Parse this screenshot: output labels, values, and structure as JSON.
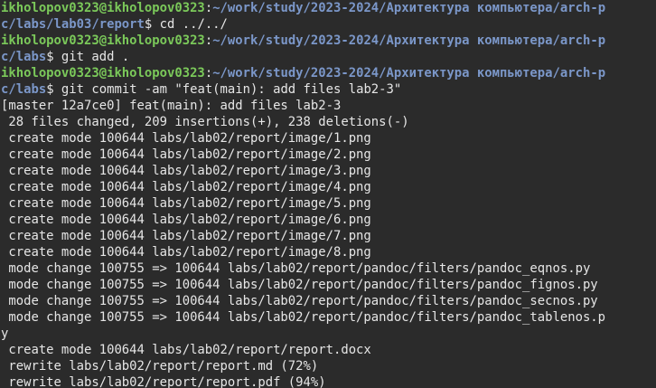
{
  "terminal": {
    "prompt_lines": [
      {
        "path": "~/work/study/2023-2024/Архитектура компьютера/arch-p",
        "cont": "c/labs/lab03/report",
        "cmd": " cd ../../"
      },
      {
        "path": "~/work/study/2023-2024/Архитектура компьютера/arch-p",
        "cont": "c/labs",
        "cmd": " git add ."
      },
      {
        "path": "~/work/study/2023-2024/Архитектура компьютера/arch-p",
        "cont": "c/labs",
        "cmd": " git commit -am \"feat(main): add files lab2-3\""
      }
    ],
    "user_host": "ikholopov0323@ikholopov0323",
    "sep": ":",
    "dollar": "$",
    "output": [
      "[master 12a7ce0] feat(main): add files lab2-3",
      " 28 files changed, 209 insertions(+), 238 deletions(-)",
      " create mode 100644 labs/lab02/report/image/1.png",
      " create mode 100644 labs/lab02/report/image/2.png",
      " create mode 100644 labs/lab02/report/image/3.png",
      " create mode 100644 labs/lab02/report/image/4.png",
      " create mode 100644 labs/lab02/report/image/5.png",
      " create mode 100644 labs/lab02/report/image/6.png",
      " create mode 100644 labs/lab02/report/image/7.png",
      " create mode 100644 labs/lab02/report/image/8.png",
      " mode change 100755 => 100644 labs/lab02/report/pandoc/filters/pandoc_eqnos.py",
      " mode change 100755 => 100644 labs/lab02/report/pandoc/filters/pandoc_fignos.py",
      " mode change 100755 => 100644 labs/lab02/report/pandoc/filters/pandoc_secnos.py",
      " mode change 100755 => 100644 labs/lab02/report/pandoc/filters/pandoc_tablenos.p",
      "y",
      " create mode 100644 labs/lab02/report/report.docx",
      " rewrite labs/lab02/report/report.md (72%)",
      " rewrite labs/lab02/report/report.pdf (94%)"
    ],
    "colors": {
      "background": "#2b2b2b",
      "user": "#7bc95a",
      "path": "#7b97c9",
      "text": "#e6e6e6"
    }
  }
}
